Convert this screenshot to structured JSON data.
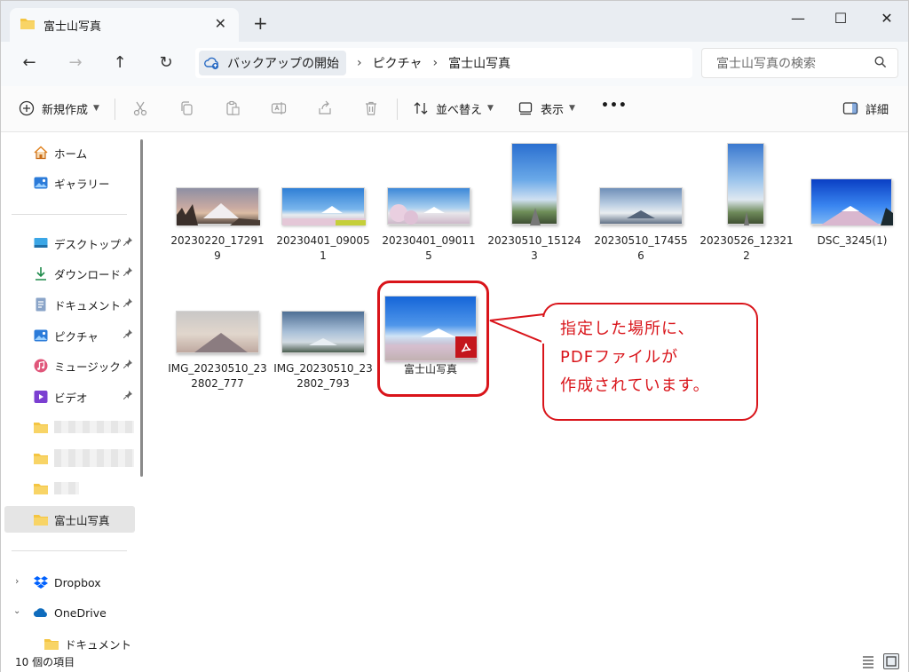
{
  "tab": {
    "title": "富士山写真",
    "close": "✕",
    "new": "+"
  },
  "window_controls": {
    "minimize": "—",
    "maximize": "☐",
    "close": "✕"
  },
  "nav": {
    "back": "←",
    "forward": "→",
    "up": "↑",
    "refresh": "↻",
    "breadcrumb": [
      "バックアップの開始",
      "ピクチャ",
      "富士山写真"
    ],
    "separator": "›",
    "search_placeholder": "富士山写真の検索"
  },
  "toolbar": {
    "new_label": "新規作成",
    "sort_label": "並べ替え",
    "view_label": "表示",
    "more_label": "•••",
    "details_label": "詳細"
  },
  "sidebar": {
    "home": "ホーム",
    "gallery": "ギャラリー",
    "pinned": [
      {
        "label": "デスクトップ",
        "icon": "desktop-icon"
      },
      {
        "label": "ダウンロード",
        "icon": "download-icon"
      },
      {
        "label": "ドキュメント",
        "icon": "document-icon"
      },
      {
        "label": "ピクチャ",
        "icon": "pictures-icon"
      },
      {
        "label": "ミュージック",
        "icon": "music-icon"
      },
      {
        "label": "ビデオ",
        "icon": "video-icon"
      }
    ],
    "selected_folder": "富士山写真",
    "dropbox": "Dropbox",
    "onedrive": "OneDrive",
    "onedrive_child": "ドキュメント",
    "pin_glyph": "📌"
  },
  "files": [
    {
      "name": "20230220_172919"
    },
    {
      "name": "20230401_090051"
    },
    {
      "name": "20230401_090115"
    },
    {
      "name": "20230510_151243"
    },
    {
      "name": "20230510_174556"
    },
    {
      "name": "20230526_123212"
    },
    {
      "name": "DSC_3245(1)"
    },
    {
      "name": "IMG_20230510_232802_777"
    },
    {
      "name": "IMG_20230510_232802_793"
    },
    {
      "name": "富士山写真"
    }
  ],
  "callout": {
    "lines": [
      "指定した場所に、",
      "PDFファイルが",
      "作成されています。"
    ]
  },
  "status": {
    "count": "10 個の項目"
  },
  "colors": {
    "accent": "#d9141a",
    "folder": "#f4c542",
    "pdf": "#c4161c"
  }
}
